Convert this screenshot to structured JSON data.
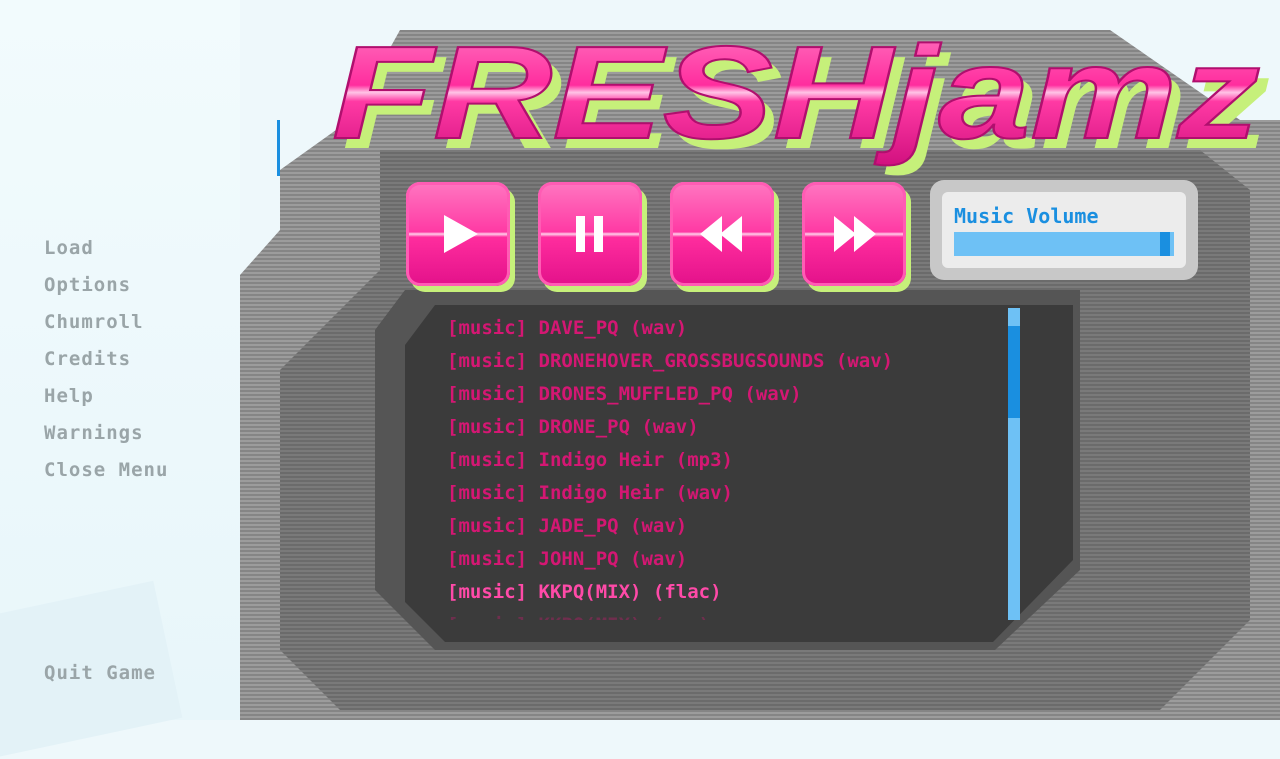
{
  "menu": {
    "items": [
      {
        "label": "Load"
      },
      {
        "label": "Options"
      },
      {
        "label": "Chumroll"
      },
      {
        "label": "Credits"
      },
      {
        "label": "Help"
      },
      {
        "label": "Warnings"
      },
      {
        "label": "Close Menu"
      }
    ],
    "quit_label": "Quit Game"
  },
  "player": {
    "title": "FRESHjamz",
    "volume_label": "Music Volume",
    "volume_level": 0.98,
    "buttons": {
      "play": "play-icon",
      "pause": "pause-icon",
      "rewind": "rewind-icon",
      "fast_forward": "fast-forward-icon"
    },
    "tracks": [
      "[music] DAVE_PQ (wav)",
      "[music] DRONEHOVER_GROSSBUGSOUNDS (wav)",
      "[music] DRONES_MUFFLED_PQ (wav)",
      "[music] DRONE_PQ (wav)",
      "[music] Indigo Heir (mp3)",
      "[music] Indigo Heir (wav)",
      "[music] JADE_PQ (wav)",
      "[music] JOHN_PQ (wav)",
      "[music] KKPQ(MIX) (flac)",
      "[music] KKPQ(MIX) (wav)"
    ],
    "selected_index": 8
  },
  "colors": {
    "pink": "#ff2d9e",
    "lime": "#c6f07a",
    "accent_blue": "#1a8fe0",
    "track_text": "#d41773",
    "menu_text": "#9aa5a8"
  }
}
